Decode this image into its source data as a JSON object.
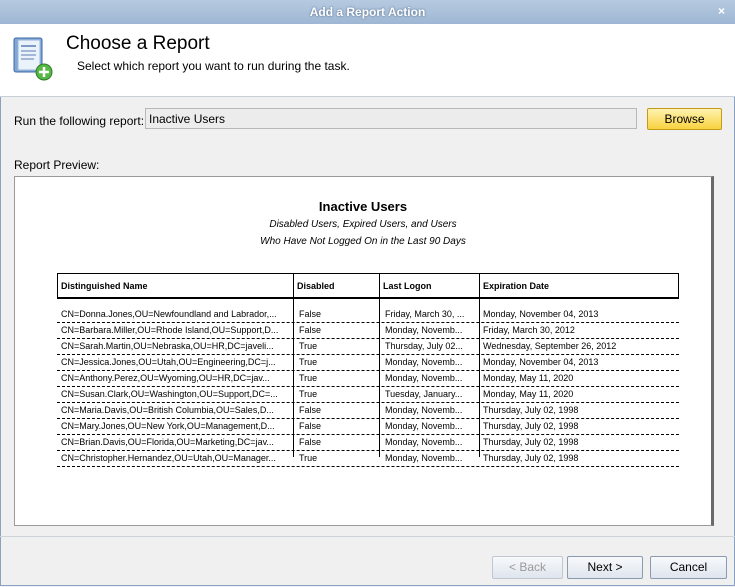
{
  "window": {
    "title": "Add a Report Action",
    "close_glyph": "×"
  },
  "header": {
    "title": "Choose a Report",
    "subtitle": "Select which report you want to run during the task."
  },
  "run_report": {
    "label": "Run the following report:",
    "value": "Inactive Users",
    "browse_label": "Browse"
  },
  "preview": {
    "label": "Report Preview:",
    "title": "Inactive Users",
    "subtitle1": "Disabled Users, Expired Users, and Users",
    "subtitle2": "Who Have Not Logged On in the Last 90 Days",
    "columns": [
      "Distinguished Name",
      "Disabled",
      "Last Logon",
      "Expiration Date"
    ],
    "rows": [
      [
        "CN=Donna.Jones,OU=Newfoundland and Labrador,...",
        "False",
        "Friday, March 30, ...",
        "Monday, November 04, 2013"
      ],
      [
        "CN=Barbara.Miller,OU=Rhode Island,OU=Support,D...",
        "False",
        "Monday, Novemb...",
        "Friday, March 30, 2012"
      ],
      [
        "CN=Sarah.Martin,OU=Nebraska,OU=HR,DC=javeli...",
        "True",
        "Thursday, July 02...",
        "Wednesday, September 26, 2012"
      ],
      [
        "CN=Jessica.Jones,OU=Utah,OU=Engineering,DC=j...",
        "True",
        "Monday, Novemb...",
        "Monday, November 04, 2013"
      ],
      [
        "CN=Anthony.Perez,OU=Wyoming,OU=HR,DC=jav...",
        "True",
        "Monday, Novemb...",
        "Monday, May 11, 2020"
      ],
      [
        "CN=Susan.Clark,OU=Washington,OU=Support,DC=...",
        "True",
        "Tuesday, January...",
        "Monday, May 11, 2020"
      ],
      [
        "CN=Maria.Davis,OU=British Columbia,OU=Sales,D...",
        "False",
        "Monday, Novemb...",
        "Thursday, July 02, 1998"
      ],
      [
        "CN=Mary.Jones,OU=New York,OU=Management,D...",
        "False",
        "Monday, Novemb...",
        "Thursday, July 02, 1998"
      ],
      [
        "CN=Brian.Davis,OU=Florida,OU=Marketing,DC=jav...",
        "False",
        "Monday, Novemb...",
        "Thursday, July 02, 1998"
      ],
      [
        "CN=Christopher.Hernandez,OU=Utah,OU=Manager...",
        "True",
        "Monday, Novemb...",
        "Thursday, July 02, 1998"
      ]
    ]
  },
  "footer": {
    "back_label": "< Back",
    "next_label": "Next >",
    "cancel_label": "Cancel"
  },
  "colors": {
    "accent": "#f8d23f",
    "titlebar": "#9fb7d4"
  }
}
